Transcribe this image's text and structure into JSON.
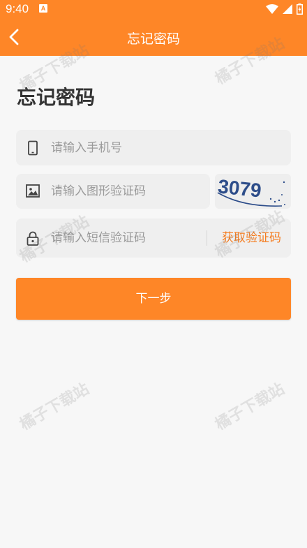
{
  "status_bar": {
    "time": "9:40",
    "notification_badge": "A"
  },
  "app_bar": {
    "title": "忘记密码",
    "back_icon": "chevron-left-icon"
  },
  "page": {
    "heading": "忘记密码"
  },
  "form": {
    "phone_placeholder": "请输入手机号",
    "captcha_placeholder": "请输入图形验证码",
    "captcha_image_text": "3079",
    "sms_placeholder": "请输入短信验证码",
    "get_code_label": "获取验证码",
    "next_label": "下一步"
  },
  "watermark": {
    "text": "橘子下载站"
  },
  "colors": {
    "accent": "#fe8627",
    "background": "#f7f7f7",
    "field": "#efefef",
    "link": "#f57c1f"
  }
}
